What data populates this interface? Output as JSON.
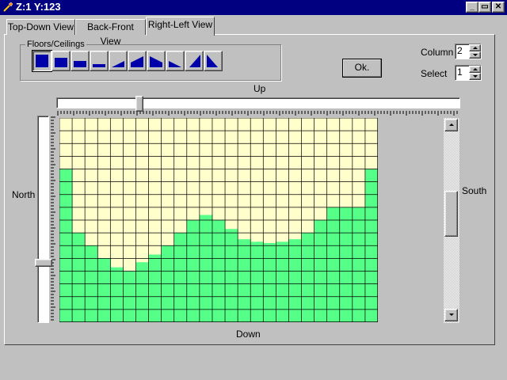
{
  "window": {
    "title": "Z:1 Y:123",
    "controls": [
      "_",
      "▭",
      "✕"
    ]
  },
  "tabs": [
    {
      "label": "Top-Down View",
      "active": false
    },
    {
      "label": "Back-Front View",
      "active": false
    },
    {
      "label": "Right-Left View",
      "active": true
    }
  ],
  "floors_group": {
    "label": "Floors/Ceilings",
    "shape_icons": [
      "full-block-icon",
      "tall-block-icon",
      "half-block-icon",
      "low-block-icon",
      "low-ramp-up-icon",
      "ramp-up-icon",
      "ramp-down-icon",
      "low-ramp-down-icon",
      "steep-ramp-up-icon",
      "steep-ramp-down-icon"
    ],
    "selected_index": 0
  },
  "ok_button": {
    "label": "Ok."
  },
  "column": {
    "label": "Column",
    "value": "2"
  },
  "select": {
    "label": "Select",
    "value": "1"
  },
  "directions": {
    "up": "Up",
    "down": "Down",
    "north": "North",
    "south": "South"
  },
  "horizontal_slider": {
    "position": 0.2
  },
  "vertical_slider": {
    "position": 0.72
  },
  "vertical_scrollbar": {
    "position": 0.45
  },
  "grid": {
    "columns": 25,
    "rows": 16,
    "heights": [
      12,
      7,
      6,
      5,
      4.3,
      4,
      4.7,
      5.3,
      6,
      7,
      8,
      8.4,
      8,
      7.3,
      6.5,
      6.3,
      6.2,
      6.3,
      6.5,
      7,
      8,
      9,
      9,
      9,
      12
    ],
    "colors": {
      "background": "#ffffcc",
      "fill": "#55ff88",
      "gridline": "#000000",
      "accent": "#0000aa"
    }
  }
}
